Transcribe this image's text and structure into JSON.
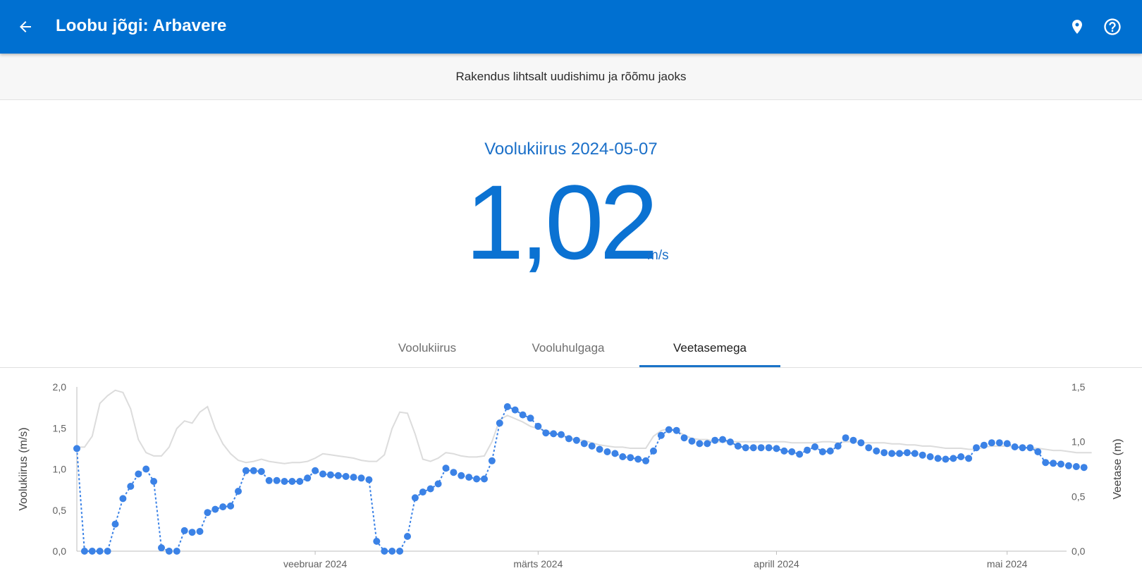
{
  "appbar": {
    "title": "Loobu jõgi: Arbavere",
    "back_icon": "arrow-left-icon",
    "location_icon": "map-pin-icon",
    "help_icon": "help-circle-icon",
    "background": "#0070d1"
  },
  "tagline": "Rakendus lihtsalt uudishimu ja rõõmu jaoks",
  "measurement": {
    "title": "Voolukiirus 2024-05-07",
    "value": "1,02",
    "unit": "m/s"
  },
  "tabs": [
    {
      "label": "Voolukiirus",
      "active": false
    },
    {
      "label": "Vooluhulgaga",
      "active": false
    },
    {
      "label": "Veetasemega",
      "active": true
    }
  ],
  "chart_data": {
    "type": "line",
    "left_axis": {
      "label": "Voolukiirus (m/s)",
      "ticks": [
        "2,0",
        "1,5",
        "1,0",
        "0,5",
        "0,0"
      ],
      "range": [
        0,
        2
      ]
    },
    "right_axis": {
      "label": "Veetase (m)",
      "ticks": [
        "1,5",
        "1,0",
        "0,5",
        "0,0"
      ],
      "range": [
        0,
        1.5
      ]
    },
    "x_ticks": [
      {
        "label": "veebruar 2024",
        "day": 31
      },
      {
        "label": "märts 2024",
        "day": 60
      },
      {
        "label": "aprill 2024",
        "day": 91
      },
      {
        "label": "mai 2024",
        "day": 121
      }
    ],
    "x_range_days": [
      0,
      128
    ],
    "series": [
      {
        "axis": "left",
        "style": "dotted-line-with-markers",
        "color": "#3b82e6",
        "values": [
          1.25,
          0.0,
          0.0,
          0.0,
          0.0,
          0.33,
          0.64,
          0.79,
          0.94,
          1.0,
          0.85,
          0.04,
          0.0,
          0.0,
          0.25,
          0.23,
          0.24,
          0.47,
          0.51,
          0.54,
          0.55,
          0.73,
          0.98,
          0.98,
          0.97,
          0.86,
          0.86,
          0.85,
          0.85,
          0.85,
          0.89,
          0.98,
          0.94,
          0.93,
          0.92,
          0.91,
          0.9,
          0.89,
          0.87,
          0.12,
          0.0,
          0.0,
          0.0,
          0.18,
          0.65,
          0.72,
          0.76,
          0.82,
          1.01,
          0.96,
          0.92,
          0.9,
          0.88,
          0.88,
          1.1,
          1.56,
          1.76,
          1.72,
          1.66,
          1.62,
          1.52,
          1.44,
          1.43,
          1.42,
          1.37,
          1.35,
          1.31,
          1.28,
          1.24,
          1.21,
          1.19,
          1.15,
          1.14,
          1.12,
          1.1,
          1.22,
          1.41,
          1.48,
          1.47,
          1.38,
          1.34,
          1.31,
          1.31,
          1.35,
          1.36,
          1.33,
          1.28,
          1.26,
          1.26,
          1.26,
          1.26,
          1.25,
          1.22,
          1.21,
          1.18,
          1.23,
          1.27,
          1.21,
          1.22,
          1.28,
          1.38,
          1.35,
          1.32,
          1.26,
          1.22,
          1.2,
          1.19,
          1.19,
          1.2,
          1.19,
          1.17,
          1.15,
          1.13,
          1.12,
          1.13,
          1.15,
          1.13,
          1.26,
          1.29,
          1.32,
          1.32,
          1.31,
          1.27,
          1.26,
          1.26,
          1.21,
          1.08,
          1.07,
          1.06,
          1.04,
          1.03,
          1.02
        ]
      },
      {
        "axis": "right",
        "style": "line",
        "color": "#dcdcdc",
        "values": [
          0.95,
          0.95,
          1.05,
          1.35,
          1.42,
          1.47,
          1.45,
          1.3,
          1.02,
          0.9,
          0.87,
          0.87,
          0.95,
          1.12,
          1.19,
          1.17,
          1.27,
          1.32,
          1.12,
          0.98,
          0.89,
          0.83,
          0.81,
          0.82,
          0.84,
          0.82,
          0.81,
          0.8,
          0.81,
          0.81,
          0.82,
          0.85,
          0.89,
          0.88,
          0.87,
          0.86,
          0.85,
          0.83,
          0.82,
          0.82,
          0.88,
          1.12,
          1.27,
          1.26,
          1.07,
          0.84,
          0.82,
          0.85,
          0.9,
          0.89,
          0.87,
          0.86,
          0.86,
          0.87,
          1.0,
          1.2,
          1.24,
          1.21,
          1.18,
          1.14,
          1.12,
          1.1,
          1.08,
          1.06,
          1.04,
          1.02,
          1.01,
          0.99,
          0.97,
          0.96,
          0.95,
          0.95,
          0.94,
          0.94,
          0.94,
          1.05,
          1.1,
          1.12,
          1.1,
          1.06,
          1.03,
          1.02,
          1.02,
          1.0,
          1.0,
          1.0,
          1.0,
          1.0,
          1.0,
          1.0,
          1.0,
          1.0,
          1.0,
          0.99,
          0.99,
          0.99,
          0.99,
          1.0,
          1.0,
          0.99,
          1.0,
          1.0,
          0.99,
          0.99,
          0.99,
          0.99,
          0.98,
          0.98,
          0.97,
          0.97,
          0.96,
          0.96,
          0.95,
          0.94,
          0.94,
          0.94,
          0.93,
          0.93,
          0.95,
          0.96,
          0.96,
          0.96,
          0.95,
          0.95,
          0.94,
          0.94,
          0.93,
          0.92,
          0.92,
          0.91,
          0.9,
          0.9,
          0.9
        ]
      }
    ]
  }
}
